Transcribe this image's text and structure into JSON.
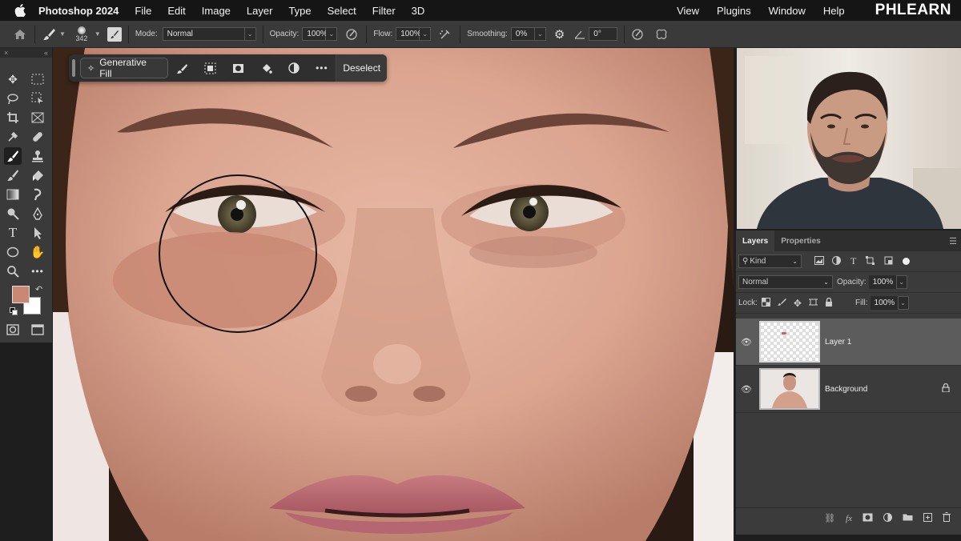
{
  "menubar": {
    "app_name": "Photoshop 2024",
    "items": [
      "File",
      "Edit",
      "Image",
      "Layer",
      "Type",
      "Select",
      "Filter",
      "3D"
    ],
    "right_items": [
      "View",
      "Plugins",
      "Window",
      "Help"
    ],
    "brand_logo": "PHLEARN"
  },
  "options_bar": {
    "brush_size": "342",
    "mode_label": "Mode:",
    "mode_value": "Normal",
    "opacity_label": "Opacity:",
    "opacity_value": "100%",
    "flow_label": "Flow:",
    "flow_value": "100%",
    "smoothing_label": "Smoothing:",
    "smoothing_value": "0%",
    "angle_value": "0°"
  },
  "taskbar": {
    "generative_fill_label": "Generative Fill",
    "deselect_label": "Deselect"
  },
  "colors": {
    "foreground": "#c98873",
    "background": "#ffffff"
  },
  "layers_panel": {
    "tabs": [
      "Layers",
      "Properties"
    ],
    "filter_kind": "Kind",
    "blend_mode": "Normal",
    "opacity_label": "Opacity:",
    "opacity_value": "100%",
    "lock_label": "Lock:",
    "fill_label": "Fill:",
    "fill_value": "100%",
    "layers": [
      {
        "name": "Layer 1",
        "selected": true
      },
      {
        "name": "Background",
        "selected": false
      }
    ]
  }
}
